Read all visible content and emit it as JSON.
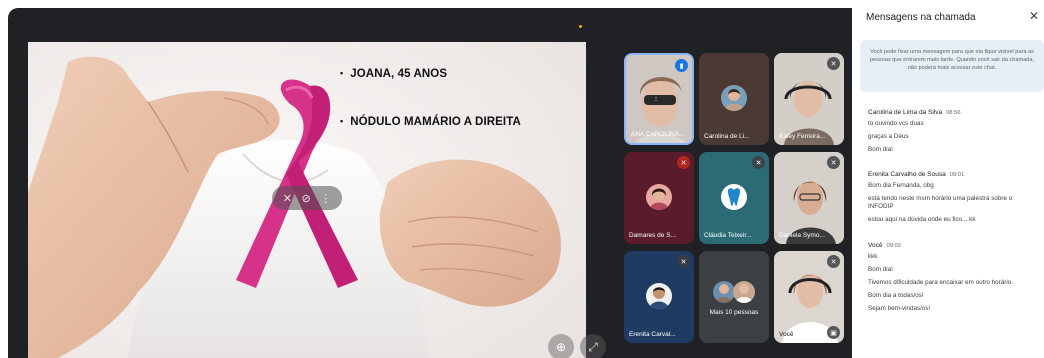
{
  "slide": {
    "bullets": [
      "JOANA, 45 ANOS",
      "NÓDULO MAMÁRIO A DIREITA"
    ],
    "bullet_char": "•"
  },
  "participants": [
    {
      "name": "ANA CAROLINA..."
    },
    {
      "name": "Carolina de Li..."
    },
    {
      "name": "Kaley Ferreira..."
    },
    {
      "name": "Damares de S..."
    },
    {
      "name": "Cláudia Teixeir..."
    },
    {
      "name": "Daniela Symo..."
    },
    {
      "name": "Erenita Carval..."
    },
    {
      "name": "Mais 10 pessoas"
    },
    {
      "name": "Você"
    }
  ],
  "chat": {
    "title": "Mensagens na chamada",
    "pin_note": "Você pode fixar uma mensagem para que ela fique visível para as pessoas que entrarem mais tarde. Quando você sair da chamada, não poderá mais acessar este chat.",
    "messages": [
      {
        "sender": "Carolina de Lima da Silva",
        "time": "08:56",
        "lines": [
          "to ouvindo vcs duas",
          "graças a Deus",
          "Bom dia!"
        ]
      },
      {
        "sender": "Erenita Carvalho de Sousa",
        "time": "09:01",
        "lines": [
          "Bom dia Fernanda, obg",
          "está tendo neste msm horário uma palestra sobre o INFODIP",
          "estou aqui na dúvida onde eu fico... kk"
        ]
      },
      {
        "sender": "Você",
        "time": "09:02",
        "lines": [
          "kkk",
          "Bom dia!",
          "Tivemos dificuldade para encaixar em outro horário.",
          "Bom dia a todas/os!",
          "Sejam bem-vindas/os!"
        ]
      }
    ]
  },
  "colors": {
    "ribbon": "#d6328a",
    "stage": "#202124",
    "pin_note_bg": "#e8eef8",
    "speaking": "#1a73e8"
  }
}
